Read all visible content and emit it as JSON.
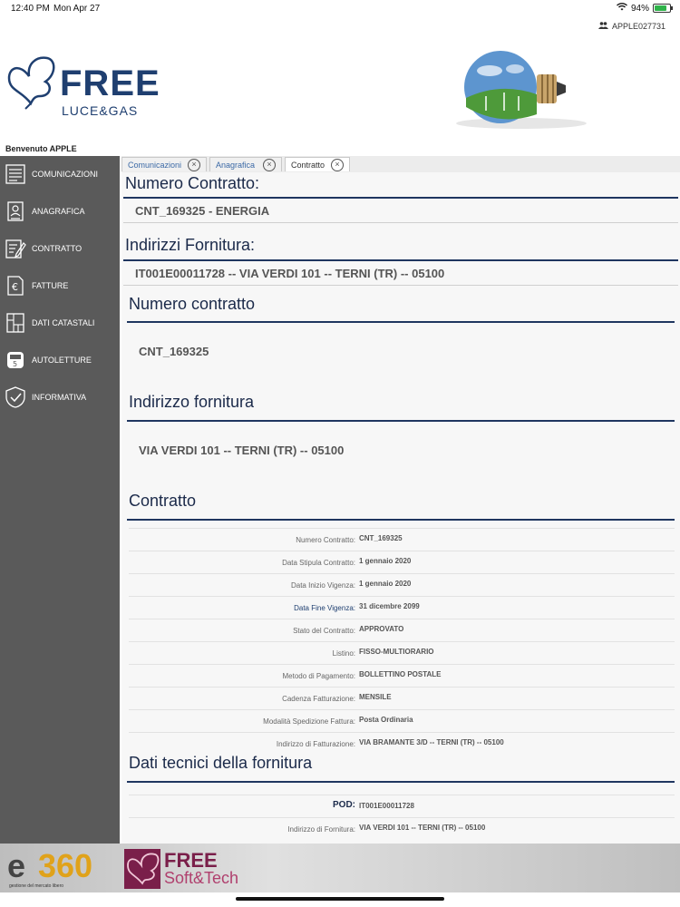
{
  "status": {
    "time": "12:40 PM",
    "date": "Mon Apr 27",
    "battery": "94%"
  },
  "user": {
    "code": "APPLE027731"
  },
  "brand": {
    "free": "FREE",
    "luce": "LUCE&GAS"
  },
  "welcome": "Benvenuto APPLE",
  "sidebar": {
    "items": [
      {
        "label": "COMUNICAZIONI",
        "icon": "document-list-icon"
      },
      {
        "label": "ANAGRAFICA",
        "icon": "user-card-icon"
      },
      {
        "label": "CONTRATTO",
        "icon": "contract-edit-icon"
      },
      {
        "label": "FATTURE",
        "icon": "euro-invoice-icon"
      },
      {
        "label": "DATI CATASTALI",
        "icon": "building-plan-icon"
      },
      {
        "label": "AUTOLETTURE",
        "icon": "meter-icon"
      },
      {
        "label": "INFORMATIVA",
        "icon": "shield-check-icon"
      }
    ]
  },
  "tabs": [
    {
      "label": "Comunicazioni"
    },
    {
      "label": "Anagrafica"
    },
    {
      "label": "Contratto"
    }
  ],
  "main": {
    "numero_contratto_title": "Numero Contratto:",
    "numero_contratto_value": "CNT_169325 - ENERGIA",
    "indirizzi_title": "Indirizzi Fornitura:",
    "indirizzi_value": "IT001E00011728 -- VIA VERDI 101 -- TERNI (TR) -- 05100",
    "sec_numero": "Numero contratto",
    "sec_numero_value": "CNT_169325",
    "sec_indirizzo": "Indirizzo fornitura",
    "sec_indirizzo_value": "VIA VERDI 101 -- TERNI (TR) -- 05100",
    "sec_contratto": "Contratto",
    "contratto_rows": [
      {
        "k": "Numero Contratto:",
        "v": "CNT_169325"
      },
      {
        "k": "Data Stipula Contratto:",
        "v": "1 gennaio 2020"
      },
      {
        "k": "Data Inizio Vigenza:",
        "v": "1 gennaio 2020"
      },
      {
        "k": "Data Fine Vigenza:",
        "v": "31 dicembre 2099"
      },
      {
        "k": "Stato del Contratto:",
        "v": "APPROVATO"
      },
      {
        "k": "Listino:",
        "v": "FISSO-MULTIORARIO"
      },
      {
        "k": "Metodo di Pagamento:",
        "v": "BOLLETTINO POSTALE"
      },
      {
        "k": "Cadenza Fatturazione:",
        "v": "MENSILE"
      },
      {
        "k": "Modalità Spedizione Fattura:",
        "v": "Posta Ordinaria"
      },
      {
        "k": "Indirizzo di Fatturazione:",
        "v": "VIA BRAMANTE 3/D -- TERNI (TR) -- 05100"
      }
    ],
    "sec_dati_tecnici": "Dati tecnici della fornitura",
    "pod_label": "POD:",
    "pod_value": "IT001E00011728",
    "ind_fornitura_label": "Indirizzo di Fornitura:",
    "ind_fornitura_value": "VIA VERDI 101 -- TERNI (TR) -- 05100"
  },
  "footer": {
    "e360_e": "e",
    "e360_n": "360",
    "e360_sub": "gestione del mercato libero",
    "fst_1": "FREE",
    "fst_2": "Soft&Tech"
  }
}
